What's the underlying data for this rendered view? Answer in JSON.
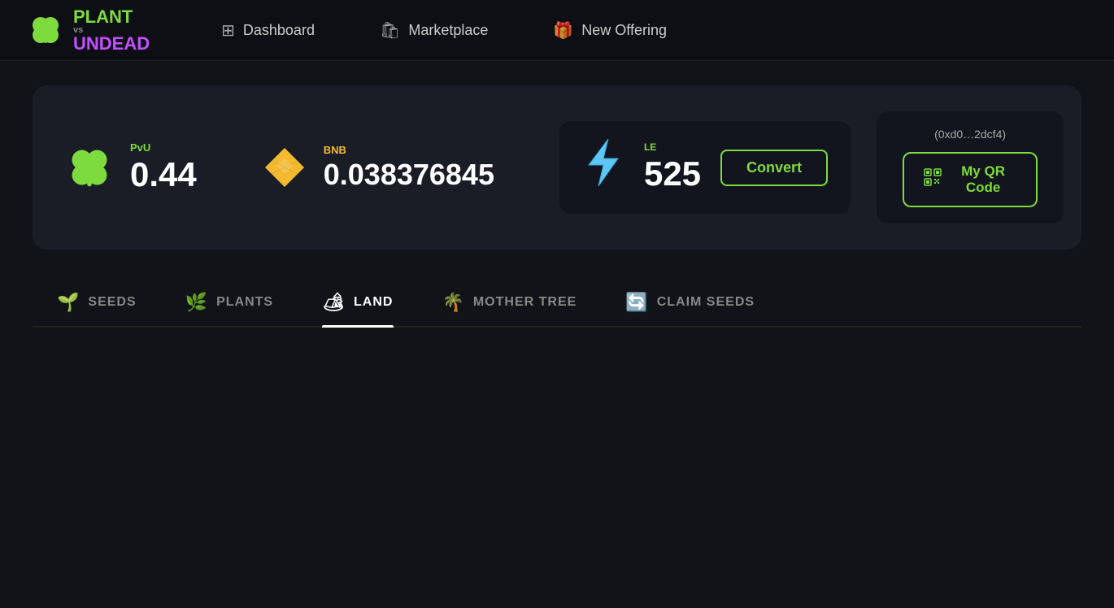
{
  "nav": {
    "logo": {
      "plant": "PLANT",
      "vs": "vs",
      "undead": "UNDEAD"
    },
    "items": [
      {
        "id": "dashboard",
        "label": "Dashboard",
        "icon": "⊞"
      },
      {
        "id": "marketplace",
        "label": "Marketplace",
        "icon": "🛍"
      },
      {
        "id": "new-offering",
        "label": "New Offering",
        "icon": "🎁"
      }
    ]
  },
  "wallet": {
    "pvu": {
      "label": "PvU",
      "value": "0.44"
    },
    "bnb": {
      "label": "BNB",
      "value": "0.038376845"
    },
    "le": {
      "label": "LE",
      "value": "525",
      "convert_label": "Convert"
    },
    "address": "(0xd0…2dcf4)",
    "qr_label": "My QR Code"
  },
  "tabs": [
    {
      "id": "seeds",
      "label": "SEEDS",
      "icon": "🌱",
      "active": false
    },
    {
      "id": "plants",
      "label": "PLANTS",
      "icon": "🌿",
      "active": false
    },
    {
      "id": "land",
      "label": "LAND",
      "icon": "🏕",
      "active": true
    },
    {
      "id": "mother-tree",
      "label": "MOTHER TREE",
      "icon": "🌴",
      "active": false
    },
    {
      "id": "claim-seeds",
      "label": "CLAIM SEEDS",
      "icon": "🔄",
      "active": false
    }
  ]
}
